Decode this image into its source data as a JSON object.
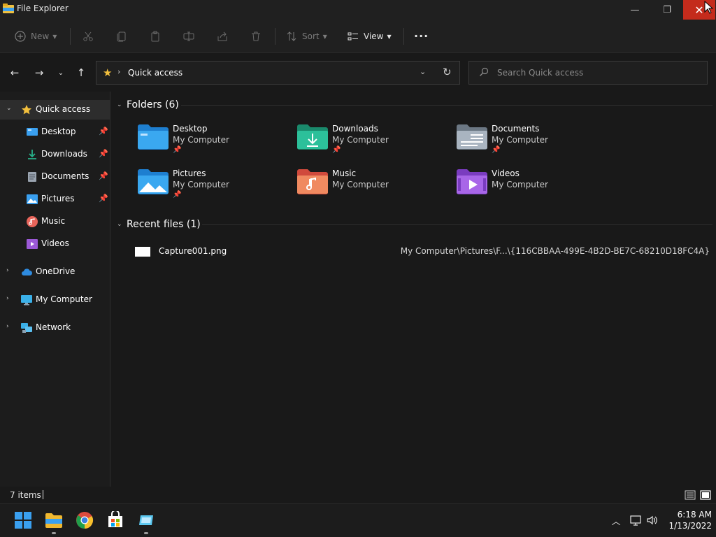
{
  "window": {
    "title": "File Explorer",
    "minimize_label": "—",
    "maximize_label": "❐",
    "close_label": "✕"
  },
  "toolbar": {
    "new_label": "New",
    "sort_label": "Sort",
    "view_label": "View",
    "more_label": "···"
  },
  "address": {
    "path": "Quick access",
    "search_placeholder": "Search Quick access"
  },
  "sidebar": {
    "items": [
      {
        "label": "Quick access",
        "icon": "star-icon",
        "pinned": false
      },
      {
        "label": "Desktop",
        "icon": "desktop-icon",
        "pinned": true
      },
      {
        "label": "Downloads",
        "icon": "download-icon",
        "pinned": true
      },
      {
        "label": "Documents",
        "icon": "document-icon",
        "pinned": true
      },
      {
        "label": "Pictures",
        "icon": "pictures-icon",
        "pinned": true
      },
      {
        "label": "Music",
        "icon": "music-icon",
        "pinned": false
      },
      {
        "label": "Videos",
        "icon": "videos-icon",
        "pinned": false
      },
      {
        "label": "OneDrive",
        "icon": "cloud-icon",
        "pinned": false
      },
      {
        "label": "My Computer",
        "icon": "computer-icon",
        "pinned": false
      },
      {
        "label": "Network",
        "icon": "network-icon",
        "pinned": false
      }
    ]
  },
  "folders": {
    "title": "Folders (6)",
    "items": [
      {
        "name": "Desktop",
        "location": "My Computer",
        "pinned": true
      },
      {
        "name": "Downloads",
        "location": "My Computer",
        "pinned": true
      },
      {
        "name": "Documents",
        "location": "My Computer",
        "pinned": true
      },
      {
        "name": "Pictures",
        "location": "My Computer",
        "pinned": true
      },
      {
        "name": "Music",
        "location": "My Computer",
        "pinned": false
      },
      {
        "name": "Videos",
        "location": "My Computer",
        "pinned": false
      }
    ]
  },
  "recent": {
    "title": "Recent files (1)",
    "files": [
      {
        "name": "Capture001.png",
        "path": "My Computer\\Pictures\\F...\\{116CBBAA-499E-4B2D-BE7C-68210D18FC4A}"
      }
    ]
  },
  "status": {
    "item_count": "7 items"
  },
  "taskbar": {
    "time": "6:18 AM",
    "date": "1/13/2022"
  },
  "colors": {
    "accent_close": "#c42b1c",
    "star": "#f3c03d",
    "folder_blue": "#3aa0f0",
    "folder_green": "#27b08a"
  }
}
